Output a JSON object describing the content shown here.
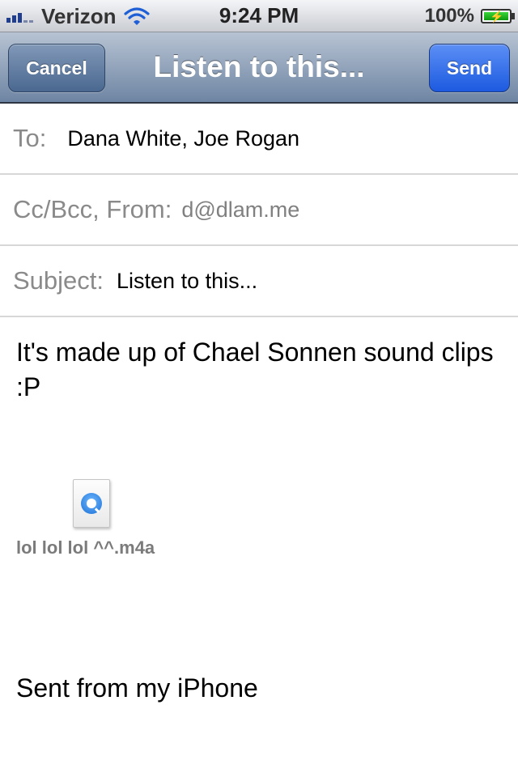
{
  "status_bar": {
    "carrier": "Verizon",
    "time": "9:24 PM",
    "battery_percent": "100%",
    "signal_bars_active": 3,
    "signal_bars_total": 5,
    "icons": [
      "signal-icon",
      "wifi-icon",
      "battery-charging-icon"
    ]
  },
  "nav": {
    "cancel_label": "Cancel",
    "title": "Listen to this...",
    "send_label": "Send",
    "accent_color": "#2a66e8"
  },
  "compose": {
    "to_label": "To:",
    "to_value": "Dana White, Joe Rogan",
    "cc_label": "Cc/Bcc, From:",
    "cc_value": "d@dlam.me",
    "subject_label": "Subject:",
    "subject_value": "Listen to this...",
    "body": "It's made up of Chael Sonnen sound clips :P",
    "attachment": {
      "icon": "quicktime-file-icon",
      "name": "lol lol lol ^^.m4a"
    },
    "signature": "Sent from my iPhone"
  }
}
